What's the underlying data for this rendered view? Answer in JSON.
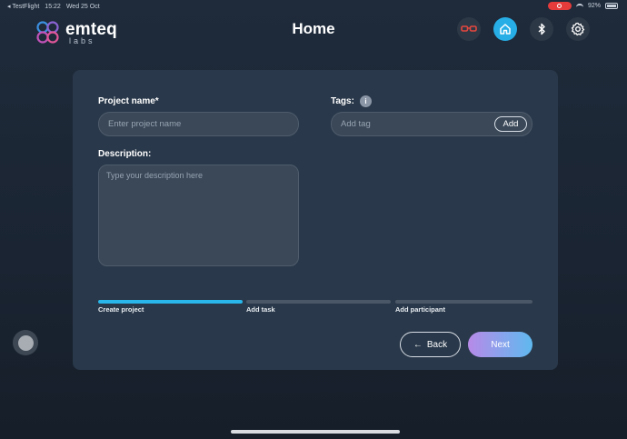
{
  "status_bar": {
    "back_app": "◂ TestFlight",
    "time": "15:22",
    "date": "Wed 25 Oct",
    "battery": "92%"
  },
  "header": {
    "logo_main": "emteq",
    "logo_sub": "labs",
    "title": "Home",
    "icons": [
      "glasses-icon",
      "home-icon",
      "bluetooth-icon",
      "gear-icon"
    ]
  },
  "form": {
    "project_name_label": "Project name*",
    "project_name_placeholder": "Enter project name",
    "project_name_value": "",
    "tags_label": "Tags:",
    "tags_info": "i",
    "tags_placeholder": "Add tag",
    "tags_value": "",
    "add_tag_label": "Add",
    "description_label": "Description:",
    "description_placeholder": "Type your description here",
    "description_value": ""
  },
  "steps": {
    "current": 1,
    "items": [
      {
        "label": "Create project",
        "done": true
      },
      {
        "label": "Add task",
        "done": false
      },
      {
        "label": "Add participant",
        "done": false
      }
    ]
  },
  "actions": {
    "back_label": "Back",
    "back_icon": "←",
    "next_label": "Next"
  },
  "colors": {
    "accent": "#27aee6",
    "progress_done": "#29b6ea",
    "recording": "#e53b3b",
    "next_gradient_start": "#b78ae8",
    "next_gradient_end": "#5fb9ef"
  }
}
